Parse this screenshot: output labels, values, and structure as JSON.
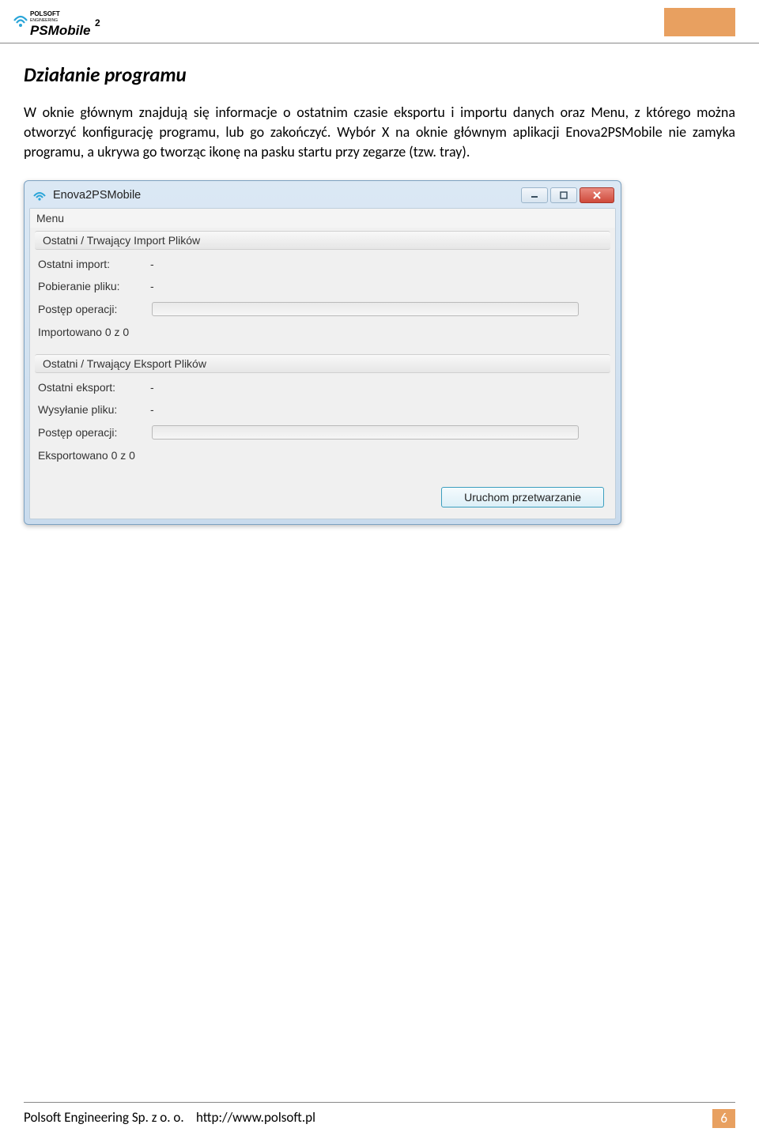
{
  "header": {
    "logo_top": "POLSOFT",
    "logo_sub": "ENGINEERING",
    "logo_main": "PSMobile",
    "logo_sup": "2"
  },
  "section": {
    "title": "Działanie programu",
    "paragraph": "W oknie głównym znajdują się informacje o ostatnim czasie eksportu i importu danych oraz Menu, z którego można otworzyć konfigurację programu, lub go zakończyć. Wybór X na oknie głównym aplikacji Enova2PSMobile nie zamyka programu, a ukrywa go tworząc ikonę na pasku startu przy zegarze (tzw. tray)."
  },
  "window": {
    "title": "Enova2PSMobile",
    "menu_label": "Menu",
    "group_import": "Ostatni / Trwający Import Plików",
    "import": {
      "last_label": "Ostatni import:",
      "last_value": "-",
      "file_label": "Pobieranie pliku:",
      "file_value": "-",
      "progress_label": "Postęp operacji:",
      "count": "Importowano 0 z 0"
    },
    "group_export": "Ostatni / Trwający Eksport Plików",
    "export": {
      "last_label": "Ostatni eksport:",
      "last_value": "-",
      "file_label": "Wysyłanie pliku:",
      "file_value": "-",
      "progress_label": "Postęp operacji:",
      "count": "Eksportowano 0 z 0"
    },
    "run_button": "Uruchom przetwarzanie"
  },
  "footer": {
    "company": "Polsoft Engineering Sp. z o. o.",
    "url": "http://www.polsoft.pl",
    "page": "6"
  }
}
